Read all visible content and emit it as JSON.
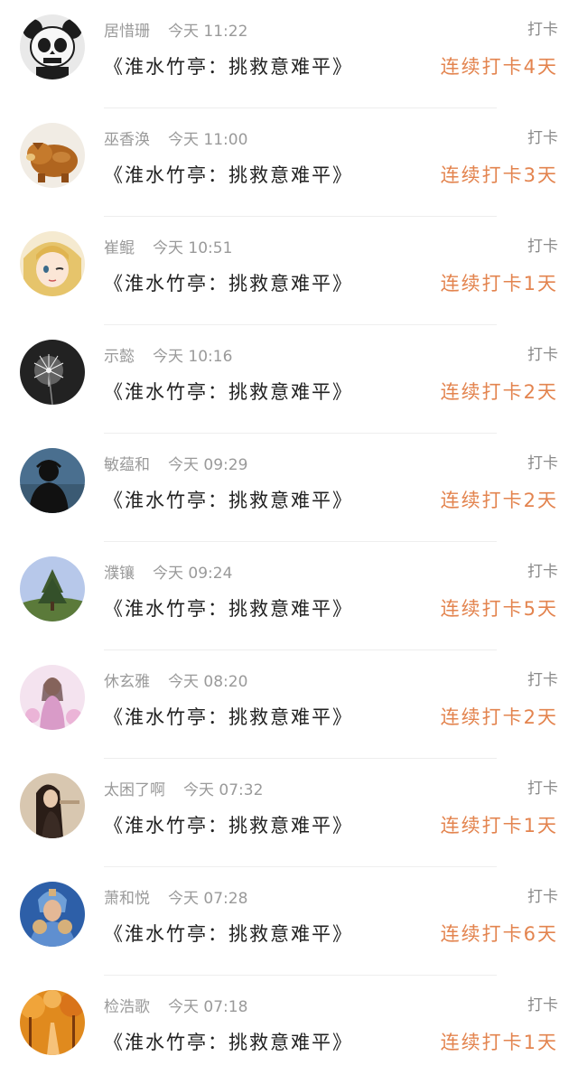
{
  "checkins": [
    {
      "name": "居惜珊",
      "time": "今天 11:22",
      "label": "打卡",
      "title": "《淮水竹亭：挑救意难平》",
      "streak": "连续打卡4天",
      "avatar_icon": "panda-skull-avatar-icon",
      "colors": [
        "#1c1c1c",
        "#e9e9e9"
      ]
    },
    {
      "name": "巫香涣",
      "time": "今天 11:00",
      "label": "打卡",
      "title": "《淮水竹亭：挑救意难平》",
      "streak": "连续打卡3天",
      "avatar_icon": "wooden-pig-avatar-icon",
      "colors": [
        "#a55a1f",
        "#e9c27a"
      ]
    },
    {
      "name": "崔鲲",
      "time": "今天 10:51",
      "label": "打卡",
      "title": "《淮水竹亭：挑救意难平》",
      "streak": "连续打卡1天",
      "avatar_icon": "anime-girl-avatar-icon",
      "colors": [
        "#e6c46b",
        "#f5ead0"
      ]
    },
    {
      "name": "示懿",
      "time": "今天 10:16",
      "label": "打卡",
      "title": "《淮水竹亭：挑救意难平》",
      "streak": "连续打卡2天",
      "avatar_icon": "dandelion-avatar-icon",
      "colors": [
        "#222222",
        "#f2f2f2"
      ]
    },
    {
      "name": "敏蕴和",
      "time": "今天 09:29",
      "label": "打卡",
      "title": "《淮水竹亭：挑救意难平》",
      "streak": "连续打卡2天",
      "avatar_icon": "silhouette-avatar-icon",
      "colors": [
        "#4a6f8f",
        "#111111"
      ]
    },
    {
      "name": "濮镶",
      "time": "今天 09:24",
      "label": "打卡",
      "title": "《淮水竹亭：挑救意难平》",
      "streak": "连续打卡5天",
      "avatar_icon": "tree-sky-avatar-icon",
      "colors": [
        "#b7c8ea",
        "#3f5a2d"
      ]
    },
    {
      "name": "休玄雅",
      "time": "今天 08:20",
      "label": "打卡",
      "title": "《淮水竹亭：挑救意难平》",
      "streak": "连续打卡2天",
      "avatar_icon": "flower-girl-avatar-icon",
      "colors": [
        "#f4e3ef",
        "#d99bc8"
      ]
    },
    {
      "name": "太困了啊",
      "time": "今天 07:32",
      "label": "打卡",
      "title": "《淮水竹亭：挑救意难平》",
      "streak": "连续打卡1天",
      "avatar_icon": "girl-portrait-avatar-icon",
      "colors": [
        "#d8c7b0",
        "#2a1d17"
      ]
    },
    {
      "name": "萧和悦",
      "time": "今天 07:28",
      "label": "打卡",
      "title": "《淮水竹亭：挑救意难平》",
      "streak": "连续打卡6天",
      "avatar_icon": "game-warrior-avatar-icon",
      "colors": [
        "#2d5fa8",
        "#d6b07a"
      ]
    },
    {
      "name": "检浩歌",
      "time": "今天 07:18",
      "label": "打卡",
      "title": "《淮水竹亭：挑救意难平》",
      "streak": "连续打卡1天",
      "avatar_icon": "autumn-road-avatar-icon",
      "colors": [
        "#e08a1e",
        "#7a3a0c"
      ]
    }
  ]
}
